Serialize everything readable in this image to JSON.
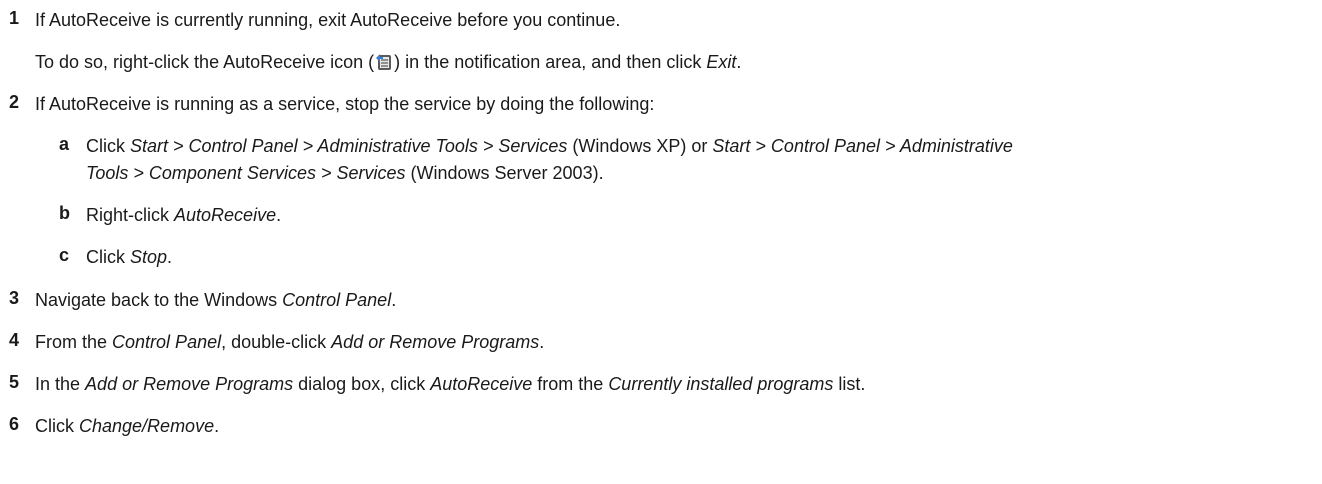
{
  "steps": [
    {
      "num": "1",
      "text_parts": [
        "If AutoReceive is currently running, exit AutoReceive before you continue."
      ],
      "note_parts": {
        "a": "To do so, right-click the AutoReceive icon (",
        "icon": "autoreceive-tray-icon",
        "b": ") in the notification area, and then click ",
        "c_italic": "Exit",
        "d": "."
      }
    },
    {
      "num": "2",
      "text": "If AutoReceive is running as a service, stop the service by doing the following:",
      "substeps": [
        {
          "letter": "a",
          "line1": {
            "p1": "Click ",
            "i1": "Start > Control Panel > Administrative Tools > Services",
            "p2": " (Windows XP) or ",
            "i2": "Start > Control Panel > Administrative"
          },
          "line2": {
            "i1": "Tools > Component Services > Services",
            "p1": " (Windows Server 2003)."
          }
        },
        {
          "letter": "b",
          "p1": "Right-click ",
          "i1": "AutoReceive",
          "p2": "."
        },
        {
          "letter": "c",
          "p1": "Click ",
          "i1": "Stop",
          "p2": "."
        }
      ]
    },
    {
      "num": "3",
      "p1": "Navigate back to the Windows ",
      "i1": "Control Panel",
      "p2": "."
    },
    {
      "num": "4",
      "p1": "From the ",
      "i1": "Control Panel",
      "p2": ", double-click ",
      "i2": "Add or Remove Programs",
      "p3": "."
    },
    {
      "num": "5",
      "p1": "In the ",
      "i1": "Add or Remove Programs",
      "p2": " dialog box, click ",
      "i2": "AutoReceive",
      "p3": " from the ",
      "i3": "Currently installed programs",
      "p4": " list."
    },
    {
      "num": "6",
      "p1": "Click ",
      "i1": "Change/Remove",
      "p2": "."
    }
  ],
  "colors": {
    "text": "#1a1a1a",
    "icon_blue": "#3b7fd0"
  }
}
